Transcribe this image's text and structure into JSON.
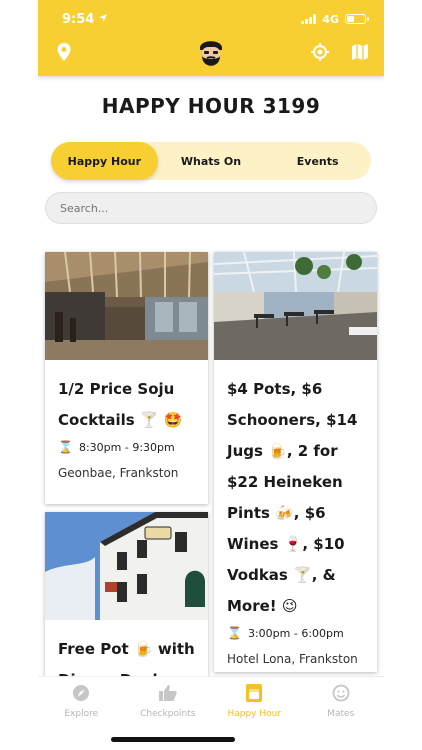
{
  "status": {
    "time": "9:54",
    "network": "4G"
  },
  "header": {
    "title": "HAPPY HOUR 3199"
  },
  "tabs": [
    {
      "label": "Happy Hour",
      "active": true
    },
    {
      "label": "Whats On",
      "active": false
    },
    {
      "label": "Events",
      "active": false
    }
  ],
  "search": {
    "placeholder": "Search..."
  },
  "cards": [
    {
      "deal": "1/2 Price Soju Cocktails 🍸 🤩",
      "time": "8:30pm - 9:30pm",
      "venue": "Geonbae, Frankston"
    },
    {
      "deal": "$4 Pots, $6 Schooners, $14 Jugs 🍺, 2 for $22 Heineken Pints 🍻, $6 Wines 🍷, $10 Vodkas 🍸, & More! 😉",
      "time": "3:00pm - 6:00pm",
      "venue": "Hotel Lona, Frankston"
    },
    {
      "deal": "Free Pot 🍺 with Dinner Deal",
      "time": "",
      "venue": ""
    }
  ],
  "nav": [
    {
      "label": "Explore",
      "icon": "compass-icon",
      "active": false
    },
    {
      "label": "Checkpoints",
      "icon": "thumbs-up-icon",
      "active": false
    },
    {
      "label": "Happy Hour",
      "icon": "beer-glass-icon",
      "active": true
    },
    {
      "label": "Mates",
      "icon": "smiley-icon",
      "active": false
    }
  ],
  "colors": {
    "accent": "#f7cf33",
    "tab_track": "#fdf1c6",
    "nav_active": "#f3c21c",
    "nav_inactive": "#b5b5b5"
  }
}
